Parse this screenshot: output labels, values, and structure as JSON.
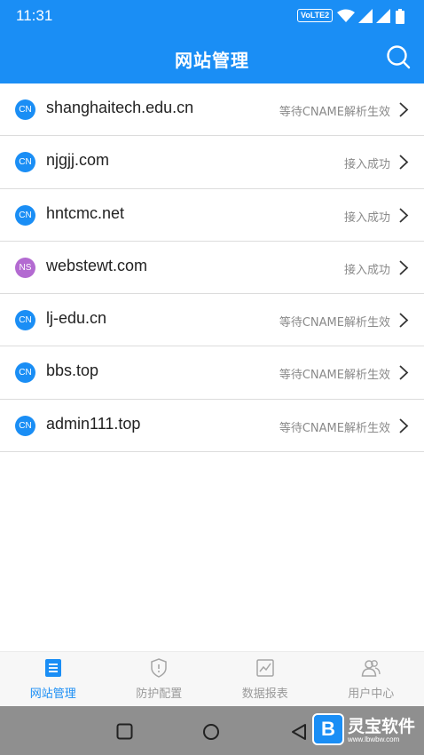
{
  "status_bar": {
    "time": "11:31",
    "volte": "VoLTE2"
  },
  "header": {
    "title": "网站管理",
    "search_icon": "search-icon"
  },
  "sites": [
    {
      "badge": "CN",
      "domain": "shanghaitech.edu.cn",
      "status": "等待CNAME解析生效",
      "badge_color": "#1a8ef5"
    },
    {
      "badge": "CN",
      "domain": "njgjj.com",
      "status": "接入成功",
      "badge_color": "#1a8ef5"
    },
    {
      "badge": "CN",
      "domain": "hntcmc.net",
      "status": "接入成功",
      "badge_color": "#1a8ef5"
    },
    {
      "badge": "NS",
      "domain": "webstewt.com",
      "status": "接入成功",
      "badge_color": "#b36ad1"
    },
    {
      "badge": "CN",
      "domain": "lj-edu.cn",
      "status": "等待CNAME解析生效",
      "badge_color": "#1a8ef5"
    },
    {
      "badge": "CN",
      "domain": "bbs.top",
      "status": "等待CNAME解析生效",
      "badge_color": "#1a8ef5"
    },
    {
      "badge": "CN",
      "domain": "admin111.top",
      "status": "等待CNAME解析生效",
      "badge_color": "#1a8ef5"
    }
  ],
  "tabs": [
    {
      "label": "网站管理",
      "icon": "site-list-icon",
      "active": true
    },
    {
      "label": "防护配置",
      "icon": "shield-icon",
      "active": false
    },
    {
      "label": "数据报表",
      "icon": "chart-icon",
      "active": false
    },
    {
      "label": "用户中心",
      "icon": "users-icon",
      "active": false
    }
  ],
  "watermark": {
    "logo": "B",
    "name": "灵宝软件",
    "url": "www.lbwbw.com"
  },
  "colors": {
    "primary": "#1a8ef5",
    "ns_badge": "#b36ad1",
    "status_text": "#8a8a8a"
  }
}
